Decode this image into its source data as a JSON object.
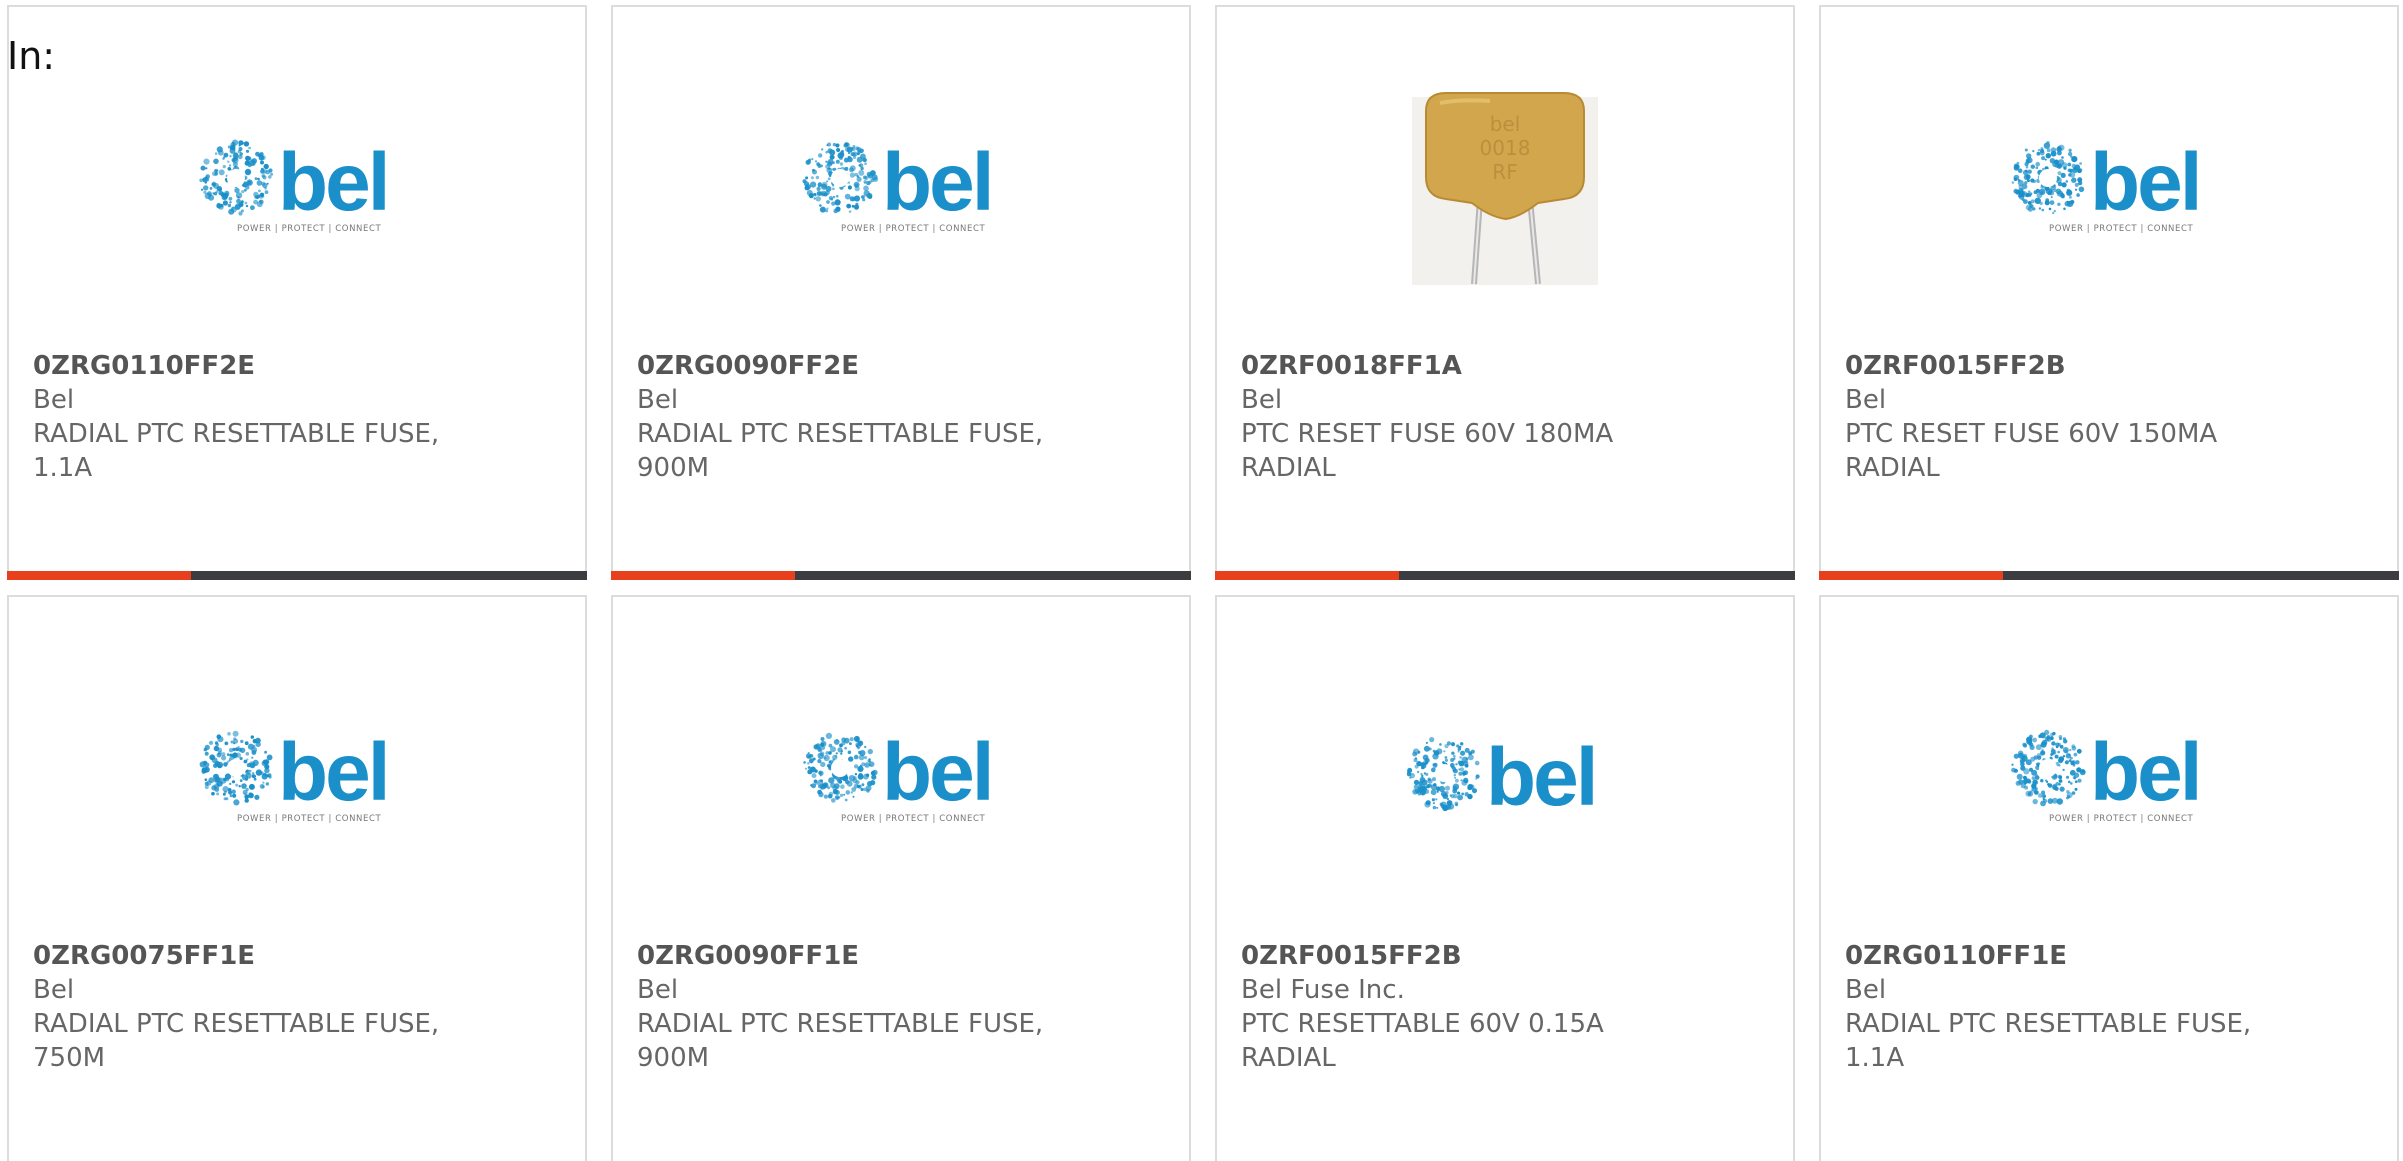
{
  "header": {
    "in_label": "In:"
  },
  "colors": {
    "accent": "#e8401c",
    "bar_dark": "#3b3d40",
    "bel_blue": "#1a8fc9",
    "text": "#666666",
    "card_border": "#dcdcdc"
  },
  "products": [
    {
      "part_number": "0ZRG0110FF2E",
      "manufacturer": "Bel",
      "description": "RADIAL PTC RESETTABLE FUSE, 1.1A",
      "image": "bel-logo",
      "logo_tagline": "POWER | PROTECT | CONNECT"
    },
    {
      "part_number": "0ZRG0090FF2E",
      "manufacturer": "Bel",
      "description": "RADIAL PTC RESETTABLE FUSE, 900M",
      "image": "bel-logo",
      "logo_tagline": "POWER | PROTECT | CONNECT"
    },
    {
      "part_number": "0ZRF0018FF1A",
      "manufacturer": "Bel",
      "description": "PTC RESET FUSE 60V 180MA RADIAL",
      "image": "ptc-fuse-photo",
      "photo_marking": [
        "bel",
        "0018",
        "RF"
      ]
    },
    {
      "part_number": "0ZRF0015FF2B",
      "manufacturer": "Bel",
      "description": "PTC RESET FUSE 60V 150MA RADIAL",
      "image": "bel-logo",
      "logo_tagline": "POWER | PROTECT | CONNECT"
    },
    {
      "part_number": "0ZRG0075FF1E",
      "manufacturer": "Bel",
      "description": "RADIAL PTC RESETTABLE FUSE, 750M",
      "image": "bel-logo",
      "logo_tagline": "POWER | PROTECT | CONNECT"
    },
    {
      "part_number": "0ZRG0090FF1E",
      "manufacturer": "Bel",
      "description": "RADIAL PTC RESETTABLE FUSE, 900M",
      "image": "bel-logo",
      "logo_tagline": "POWER | PROTECT | CONNECT"
    },
    {
      "part_number": "0ZRF0015FF2B",
      "manufacturer": "Bel Fuse Inc.",
      "description": "PTC RESETTABLE 60V 0.15A RADIAL",
      "image": "bel-logo",
      "logo_tagline": ""
    },
    {
      "part_number": "0ZRG0110FF1E",
      "manufacturer": "Bel",
      "description": "RADIAL PTC RESETTABLE FUSE, 1.1A",
      "image": "bel-logo",
      "logo_tagline": "POWER | PROTECT | CONNECT"
    }
  ]
}
